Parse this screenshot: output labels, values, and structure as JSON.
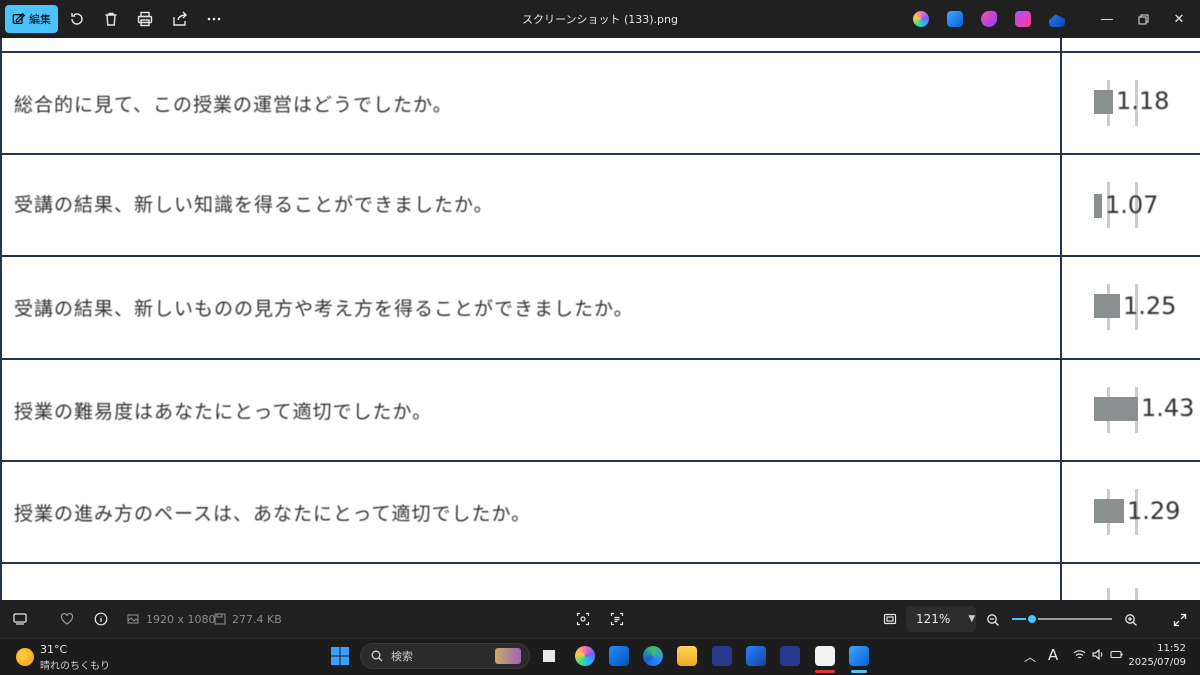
{
  "toolbar": {
    "edit_label": "編集",
    "window_title": "スクリーンショット (133).png"
  },
  "survey": {
    "rows": [
      {
        "question": "総合的に見て、この授業の運営はどうでしたか。",
        "value": 1.18
      },
      {
        "question": "受講の結果、新しい知識を得ることができましたか。",
        "value": 1.07
      },
      {
        "question": "受講の結果、新しいものの見方や考え方を得ることができましたか。",
        "value": 1.25
      },
      {
        "question": "授業の難易度はあなたにとって適切でしたか。",
        "value": 1.43
      },
      {
        "question": "授業の進み方のペースは、あなたにとって適切でしたか。",
        "value": 1.29
      }
    ],
    "value_labels": [
      "1.18",
      "1.07",
      "1.25",
      "1.43",
      "1.29"
    ]
  },
  "statusbar": {
    "dimensions": "1920 x 1080",
    "file_size": "277.4 KB",
    "zoom": "121%",
    "zoom_fraction": 0.2
  },
  "taskbar": {
    "weather_temp": "31°C",
    "weather_desc": "晴れのちくもり",
    "search_placeholder": "検索",
    "time": "11:52",
    "date": "2025/07/09"
  },
  "colors": {
    "accent": "#4cc2ff",
    "bar": "#8a8f90",
    "grid": "#26344d"
  }
}
